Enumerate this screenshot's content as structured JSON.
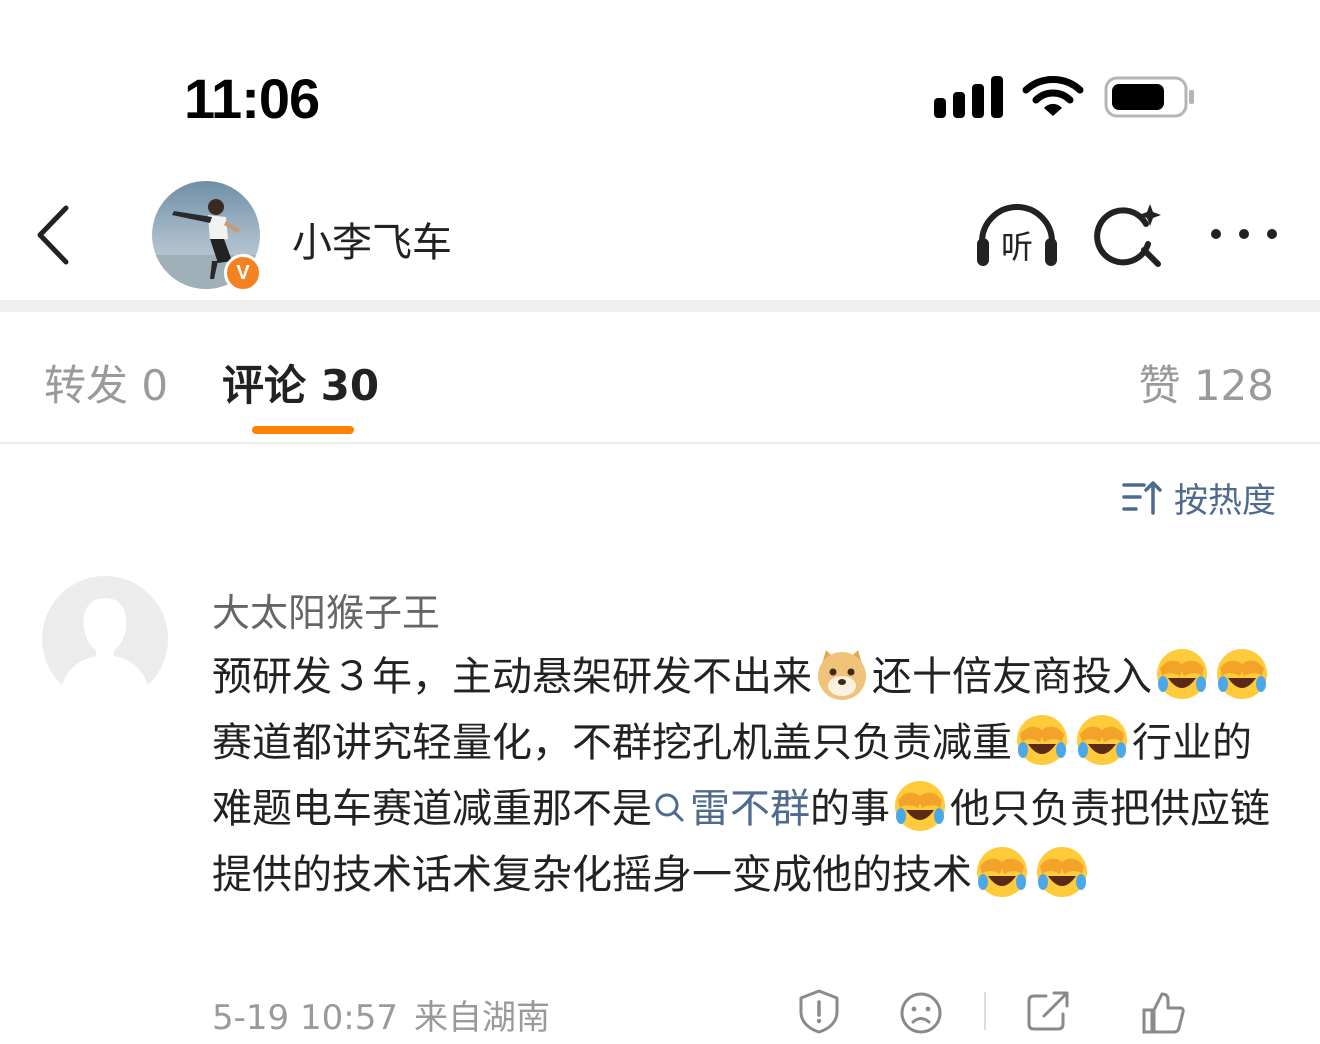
{
  "status_bar": {
    "time": "11:06",
    "icons": [
      "cellular-signal-icon",
      "wifi-icon",
      "battery-icon"
    ]
  },
  "header": {
    "back_icon": "chevron-left-icon",
    "user_name": "小李飞车",
    "verified_badge": "V",
    "actions": [
      "listen-icon",
      "search-ai-icon",
      "more-icon"
    ],
    "listen_label": "听"
  },
  "tabs": {
    "repost": {
      "label": "转发",
      "count": "0"
    },
    "comments": {
      "label": "评论",
      "count": "30"
    },
    "likes": {
      "label": "赞",
      "count": "128"
    },
    "active": "comments",
    "accent_color": "#ff8200"
  },
  "sort": {
    "label": "按热度",
    "icon": "sort-icon"
  },
  "comments": [
    {
      "author": "大太阳猴子王",
      "text_parts": {
        "p1": "预研发３年，主动悬架研发不出来",
        "p2": "还十倍友商投入",
        "p3": "赛道都讲究轻量化，不群挖孔机盖只负责减重",
        "p4": "行业的难题电车赛道减重那不是",
        "link": "雷不群",
        "p5": "的事",
        "p6": "他只负责把供应链提供的技术话术复杂化摇身一变成他的技术"
      },
      "emojis": [
        "doge-emoji",
        "laugh-cry-emoji"
      ],
      "date": "5-19 10:57",
      "location": "来自湖南",
      "actions": [
        "report-icon",
        "dislike-icon",
        "share-icon",
        "like-icon"
      ]
    }
  ],
  "colors": {
    "link": "#4e6a8e",
    "muted": "#9a9a9a",
    "primary_text": "#222222"
  }
}
